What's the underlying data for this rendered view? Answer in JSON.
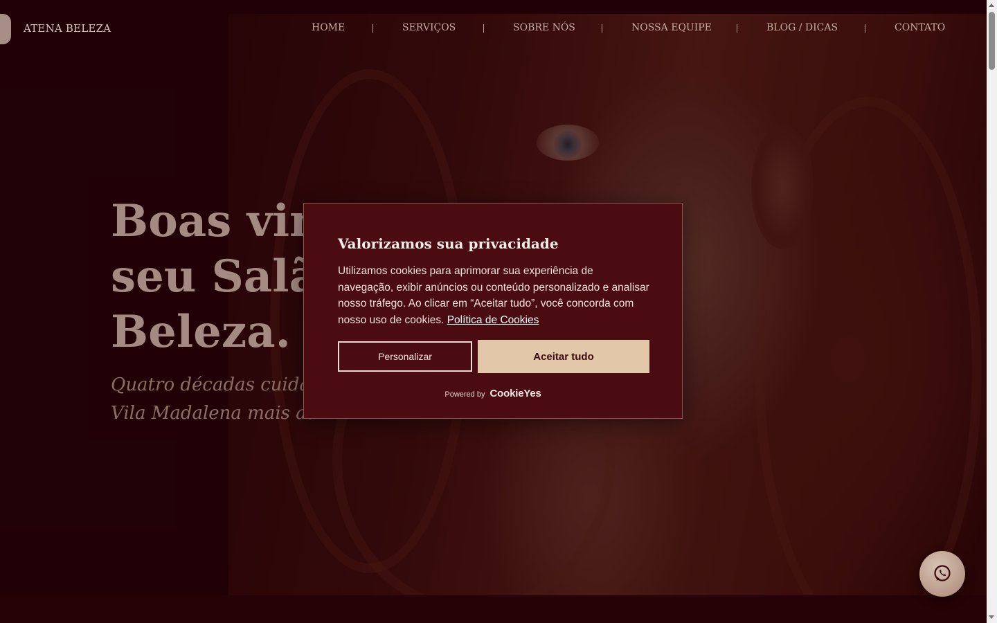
{
  "brand": {
    "name": "ATENA BELEZA",
    "logo_icon": "bust-logo-icon"
  },
  "nav": {
    "items": [
      {
        "label": "HOME"
      },
      {
        "label": "SERVIÇOS"
      },
      {
        "label": "SOBRE NÓS"
      },
      {
        "label": "NOSSA EQUIPE"
      },
      {
        "label": "BLOG / DICAS"
      },
      {
        "label": "CONTATO"
      }
    ]
  },
  "hero": {
    "title_line1": "Boas vin",
    "title_line2": "seu Salã",
    "title_line3": "Beleza.",
    "subtitle_line1": "Quatro décadas cuidando",
    "subtitle_line2": "Vila Madalena mais adm"
  },
  "cookie_banner": {
    "title": "Valorizamos sua privacidade",
    "text": "Utilizamos cookies para aprimorar sua experiência de navegação, exibir anúncios ou conteúdo personalizado e analisar nosso tráfego. Ao clicar em “Aceitar tudo”, você concorda com nosso uso de cookies.",
    "policy_link": "Política de Cookies",
    "customize_label": "Personalizar",
    "accept_label": "Aceitar tudo",
    "powered_by": "Powered by",
    "powered_brand": "CookieYes"
  },
  "whatsapp": {
    "icon": "whatsapp-icon"
  },
  "colors": {
    "background": "#2a0408",
    "modal": "#4a0c10",
    "accent_button": "#e3c7a9",
    "nav_text": "#c9aca2"
  }
}
